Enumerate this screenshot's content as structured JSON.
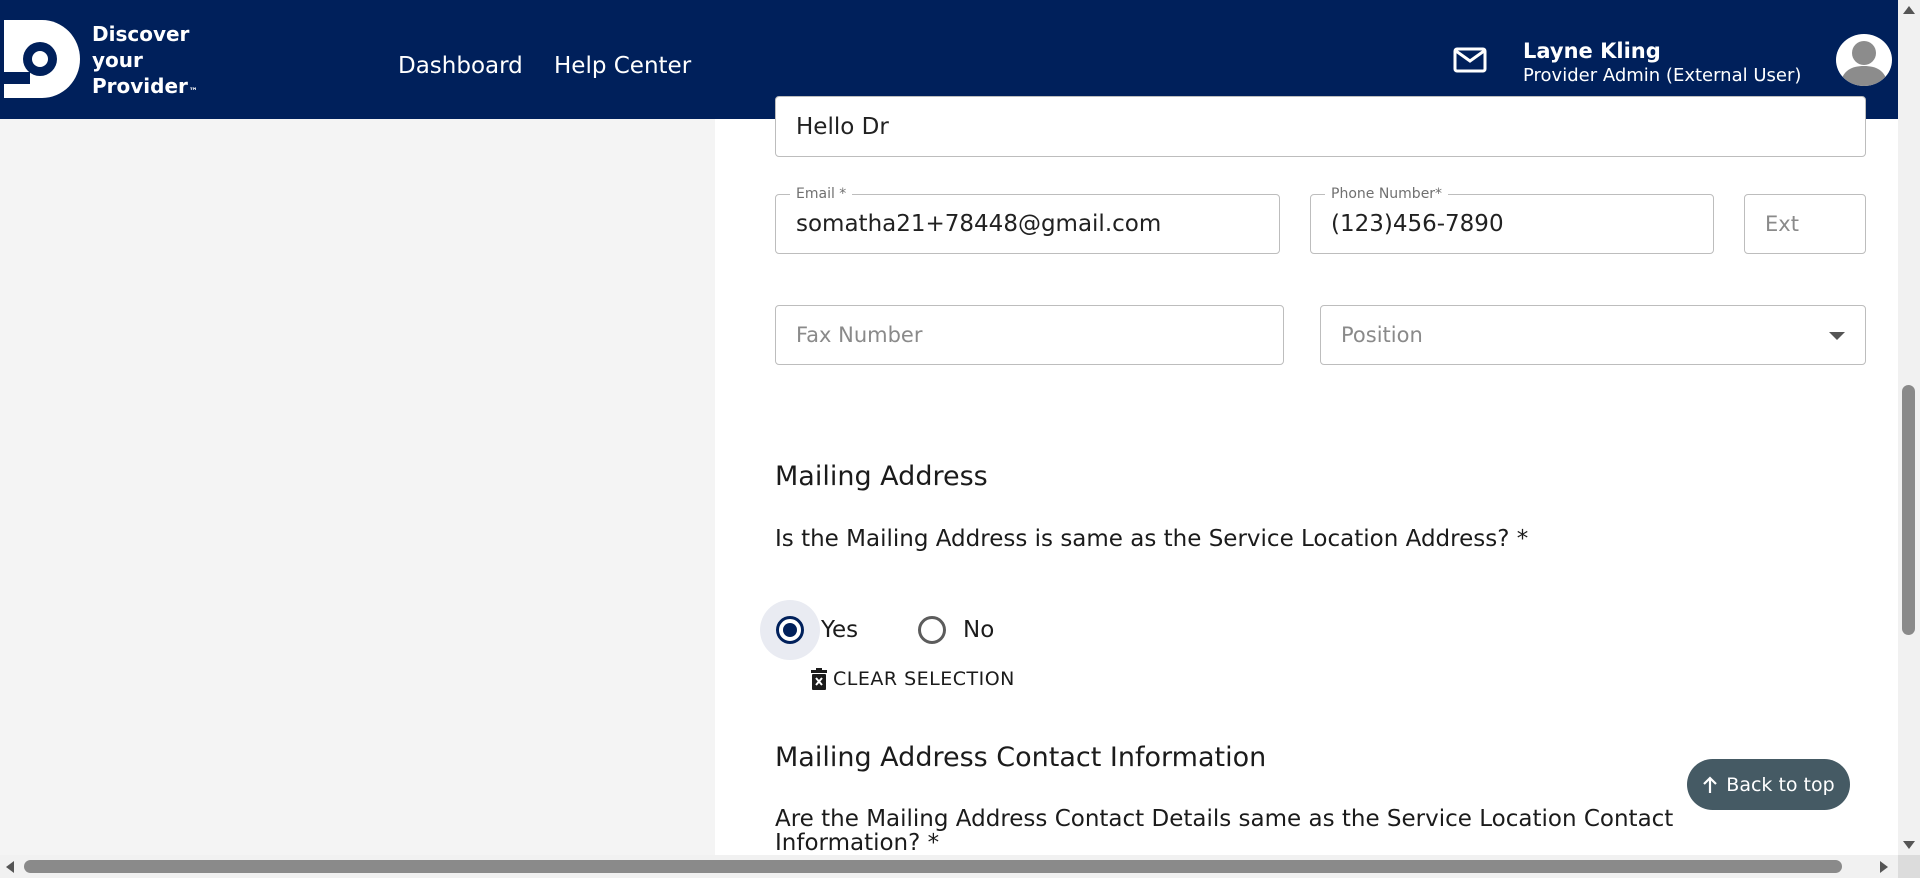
{
  "colors": {
    "header_bg": "#00205b",
    "accent": "#00205b",
    "back_to_top_bg": "#455a64"
  },
  "header": {
    "logo_lines": [
      "Discover",
      "your",
      "Provider"
    ],
    "logo_tm": "™",
    "nav": {
      "dashboard": "Dashboard",
      "help_center": "Help Center"
    },
    "user": {
      "name": "Layne Kling",
      "role": "Provider Admin (External User)"
    },
    "icons": {
      "mail": "mail-icon",
      "avatar": "avatar-icon"
    }
  },
  "form": {
    "top_field_value": "Hello Dr",
    "email": {
      "label": "Email *",
      "value": "somatha21+78448@gmail.com"
    },
    "phone": {
      "label": "Phone Number*",
      "value": "(123)456-7890"
    },
    "ext": {
      "placeholder": "Ext"
    },
    "fax": {
      "placeholder": "Fax Number"
    },
    "position": {
      "placeholder": "Position"
    }
  },
  "mailing": {
    "title": "Mailing Address",
    "question": "Is the Mailing Address is same as the Service Location Address? *",
    "options": [
      "Yes",
      "No"
    ],
    "selected": "Yes",
    "clear_label": "CLEAR SELECTION"
  },
  "contact": {
    "title": "Mailing Address Contact Information",
    "question": "Are the Mailing Address Contact Details same as the Service Location Contact Information? *"
  },
  "back_to_top": "Back to top"
}
